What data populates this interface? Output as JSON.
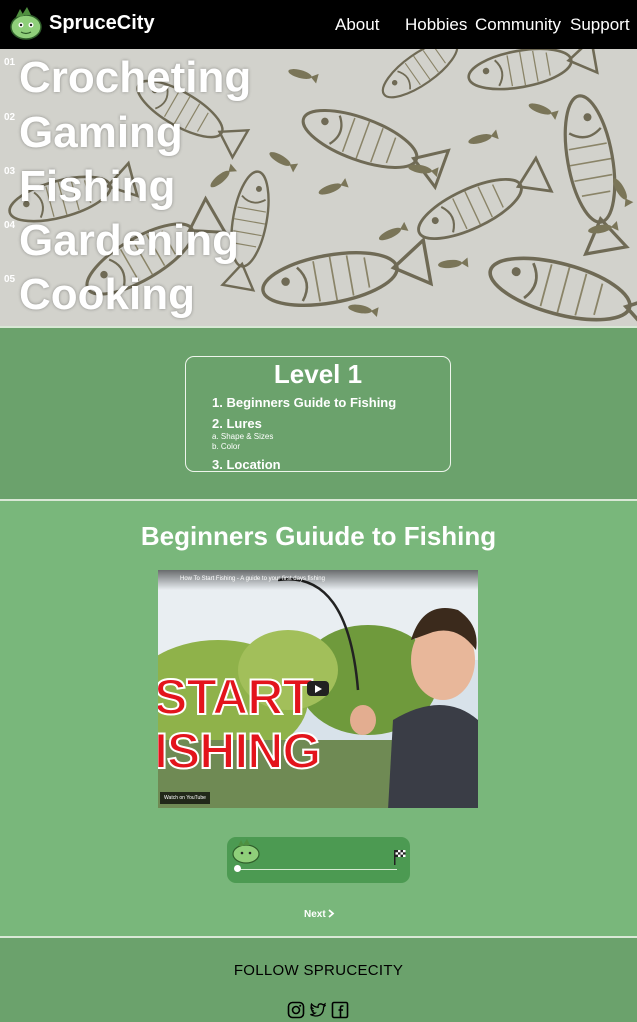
{
  "nav": {
    "brand": "SpruceCity",
    "links": [
      "About",
      "Hobbies",
      "Community",
      "Support"
    ]
  },
  "hero": {
    "hobbies": [
      {
        "num": "01",
        "name": "Crocheting"
      },
      {
        "num": "02",
        "name": "Gaming"
      },
      {
        "num": "03",
        "name": "Fishing"
      },
      {
        "num": "04",
        "name": "Gardening"
      },
      {
        "num": "05",
        "name": "Cooking"
      }
    ]
  },
  "level": {
    "title": "Level 1",
    "items": [
      {
        "label": "1. Beginners Guide to Fishing"
      },
      {
        "label": "2. Lures",
        "subs": [
          "a. Shape & Sizes",
          "b. Color"
        ]
      },
      {
        "label": "3. Location"
      }
    ]
  },
  "main": {
    "title": "Beginners Guiude to Fishing",
    "video": {
      "title": "How To Start Fishing - A guide to your first days fishing",
      "overlay_line1": "START",
      "overlay_line2": "ISHING",
      "watch_label": "Watch on YouTube"
    },
    "next_label": "Next"
  },
  "footer": {
    "follow_label": "FOLLOW SPRUCECITY",
    "socials": [
      "instagram-icon",
      "twitter-icon",
      "facebook-icon"
    ]
  },
  "colors": {
    "nav_bg": "#000000",
    "level_bg": "#6ba26c",
    "main_bg": "#79b77b",
    "progress_bg": "#4c9a52"
  }
}
